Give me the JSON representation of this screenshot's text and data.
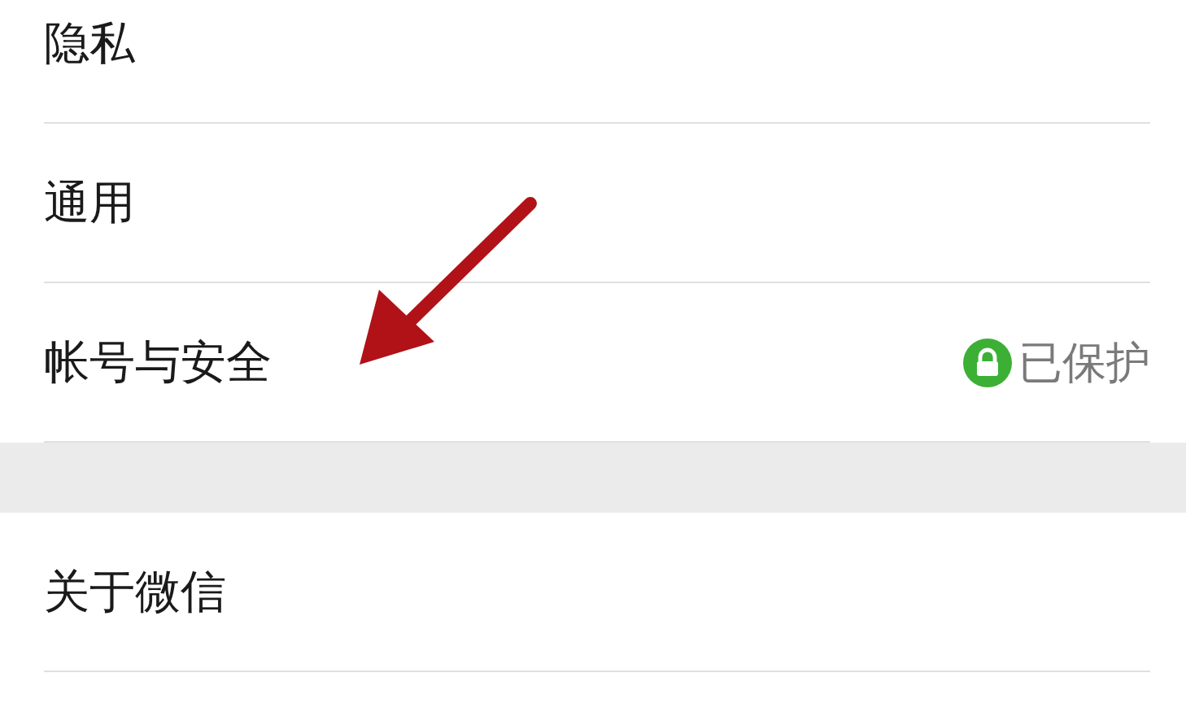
{
  "groups": [
    {
      "items": [
        {
          "label": "隐私"
        },
        {
          "label": "通用"
        },
        {
          "label": "帐号与安全",
          "status": "已保护"
        }
      ]
    },
    {
      "items": [
        {
          "label": "关于微信"
        }
      ]
    }
  ]
}
